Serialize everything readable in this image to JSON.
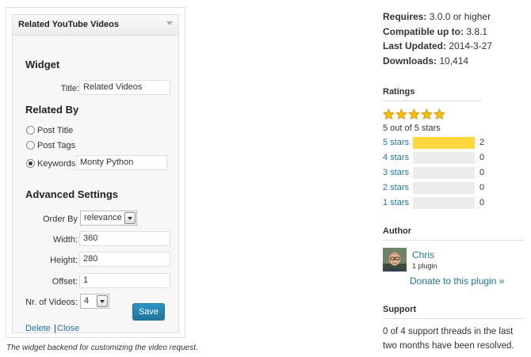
{
  "widget": {
    "title": "Related YouTube Videos",
    "section_widget": "Widget",
    "title_label": "Title:",
    "title_value": "Related Videos",
    "section_related": "Related By",
    "options": [
      "Post Title",
      "Post Tags",
      "Keywords:"
    ],
    "selected_option": "Keywords:",
    "keywords_value": "Monty Python",
    "section_advanced": "Advanced Settings",
    "order_label": "Order By",
    "order_value": "relevance",
    "width_label": "Width:",
    "width_value": "360",
    "height_label": "Height:",
    "height_value": "280",
    "offset_label": "Offset:",
    "offset_value": "1",
    "nr_label": "Nr. of Videos:",
    "nr_value": "4",
    "delete_label": "Delete",
    "separator": "|",
    "close_label": "Close",
    "save_label": "Save"
  },
  "caption": "The widget backend for customizing the video request.",
  "meta": {
    "requires_label": "Requires:",
    "requires_value": "3.0.0 or higher",
    "compatible_label": "Compatible up to:",
    "compatible_value": "3.8.1",
    "updated_label": "Last Updated:",
    "updated_value": "2014-3-27",
    "downloads_label": "Downloads:",
    "downloads_value": "10,414"
  },
  "ratings": {
    "title": "Ratings",
    "stars_filled": 5,
    "stars_total": 5,
    "summary": "5 out of 5 stars",
    "rows": [
      {
        "label": "5 stars",
        "count": "2",
        "fraction": 1.0
      },
      {
        "label": "4 stars",
        "count": "0",
        "fraction": 0
      },
      {
        "label": "3 stars",
        "count": "0",
        "fraction": 0
      },
      {
        "label": "2 stars",
        "count": "0",
        "fraction": 0
      },
      {
        "label": "1 stars",
        "count": "0",
        "fraction": 0
      }
    ]
  },
  "author": {
    "title": "Author",
    "name": "Chris",
    "plugins": "1 plugin",
    "donate": "Donate to this plugin »"
  },
  "support": {
    "title": "Support",
    "text": "0 of 4 support threads in the last two months have been resolved."
  },
  "colors": {
    "link": "#21759b",
    "star": "#ffc000",
    "rating_fill": "#ffd83d",
    "save_button": "#21759b"
  }
}
